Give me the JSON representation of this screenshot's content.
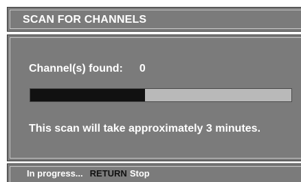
{
  "dialog": {
    "title": "SCAN FOR CHANNELS",
    "found_label": "Channel(s) found:",
    "found_count": "0",
    "progress": 0.44,
    "scan_note": "This scan will take approximately 3 minutes."
  },
  "status": {
    "state": "In progress...",
    "key": "RETURN",
    "action": "Stop"
  },
  "colors": {
    "panel": "#7b7b7b",
    "progress_fill": "#111111",
    "progress_track": "#b9b9b9"
  }
}
